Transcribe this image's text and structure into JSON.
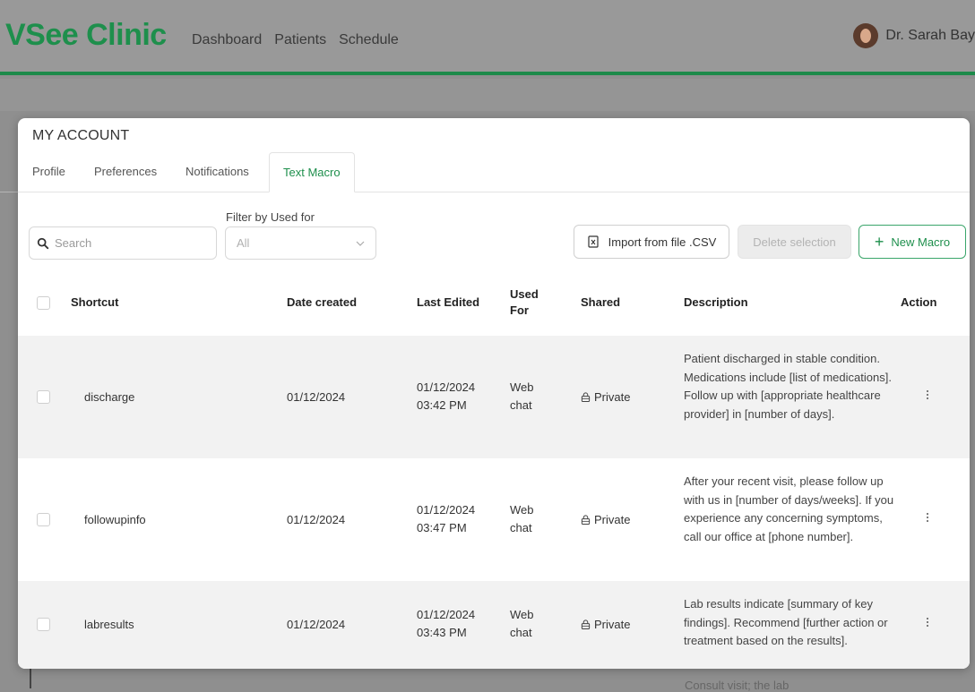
{
  "app": {
    "brand": "VSee Clinic",
    "nav": [
      "Dashboard",
      "Patients",
      "Schedule"
    ],
    "user": "Dr. Sarah Bay"
  },
  "modal": {
    "title": "MY ACCOUNT",
    "tabs": [
      {
        "label": "Profile",
        "active": false
      },
      {
        "label": "Preferences",
        "active": false
      },
      {
        "label": "Notifications",
        "active": false
      },
      {
        "label": "Text Macro",
        "active": true
      }
    ]
  },
  "toolbar": {
    "search_placeholder": "Search",
    "filter_label": "Filter by Used for",
    "filter_value": "All",
    "import_label": "Import from file .CSV",
    "delete_label": "Delete selection",
    "new_label": "New Macro"
  },
  "table": {
    "headers": {
      "shortcut": "Shortcut",
      "date_created": "Date created",
      "last_edited": "Last Edited",
      "used_for_1": "Used",
      "used_for_2": "For",
      "shared": "Shared",
      "description": "Description",
      "action": "Action"
    },
    "rows": [
      {
        "shortcut": "discharge",
        "date_created": "01/12/2024",
        "edited_date": "01/12/2024",
        "edited_time": "03:42 PM",
        "used_1": "Web",
        "used_2": "chat",
        "shared": "Private",
        "description": "Patient discharged in stable condition. Medications include [list of medications]. Follow up with [appropriate healthcare provider] in [number of days]."
      },
      {
        "shortcut": "followupinfo",
        "date_created": "01/12/2024",
        "edited_date": "01/12/2024",
        "edited_time": "03:47 PM",
        "used_1": "Web",
        "used_2": "chat",
        "shared": "Private",
        "description": "After your recent visit, please follow up with us in [number of days/weeks]. If you experience any concerning symptoms, call our office at [phone number]."
      },
      {
        "shortcut": "labresults",
        "date_created": "01/12/2024",
        "edited_date": "01/12/2024",
        "edited_time": "03:43 PM",
        "used_1": "Web",
        "used_2": "chat",
        "shared": "Private",
        "description": "Lab results indicate [summary of key findings]. Recommend [further action or treatment based on the results]."
      }
    ]
  },
  "background_text": "Consult visit; the lab",
  "colors": {
    "brand_green": "#1e8f4c",
    "accent_line": "#1d8a4a"
  }
}
